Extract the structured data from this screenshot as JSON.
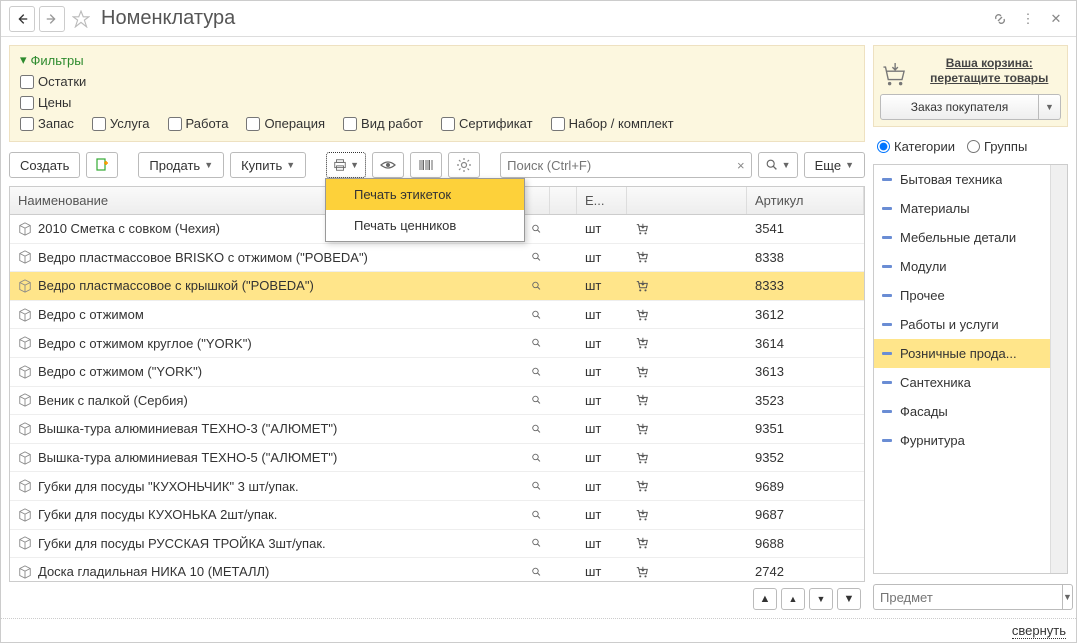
{
  "title": "Номенклатура",
  "filters": {
    "label": "Фильтры",
    "row1": [
      "Остатки"
    ],
    "row2": [
      "Цены"
    ],
    "row3": [
      "Запас",
      "Услуга",
      "Работа",
      "Операция",
      "Вид работ",
      "Сертификат",
      "Набор / комплект"
    ]
  },
  "toolbar": {
    "create": "Создать",
    "sell": "Продать",
    "buy": "Купить",
    "more": "Еще",
    "search_placeholder": "Поиск (Ctrl+F)"
  },
  "dropdown": {
    "opt1": "Печать этикеток",
    "opt2": "Печать ценников"
  },
  "columns": {
    "name": "Наименование",
    "unit": "Е...",
    "art": "Артикул"
  },
  "rows": [
    {
      "name": "2010 Сметка с совком (Чехия)",
      "unit": "шт",
      "art": "3541",
      "sel": false
    },
    {
      "name": "Ведро пластмассовое BRISKO с отжимом (\"POBEDA\")",
      "unit": "шт",
      "art": "8338",
      "sel": false
    },
    {
      "name": "Ведро пластмассовое с крышкой (\"POBEDA\")",
      "unit": "шт",
      "art": "8333",
      "sel": true
    },
    {
      "name": "Ведро с отжимом",
      "unit": "шт",
      "art": "3612",
      "sel": false
    },
    {
      "name": "Ведро с отжимом  круглое (\"YORK\")",
      "unit": "шт",
      "art": "3614",
      "sel": false
    },
    {
      "name": "Ведро с отжимом (\"YORK\")",
      "unit": "шт",
      "art": "3613",
      "sel": false
    },
    {
      "name": "Веник с палкой (Сербия)",
      "unit": "шт",
      "art": "3523",
      "sel": false
    },
    {
      "name": "Вышка-тура алюминиевая ТЕХНО-3 (\"АЛЮМЕТ\")",
      "unit": "шт",
      "art": "9351",
      "sel": false
    },
    {
      "name": "Вышка-тура алюминиевая ТЕХНО-5 (\"АЛЮМЕТ\")",
      "unit": "шт",
      "art": "9352",
      "sel": false
    },
    {
      "name": "Губки для посуды \"КУХОНЬЧИК\" 3 шт/упак.",
      "unit": "шт",
      "art": "9689",
      "sel": false
    },
    {
      "name": "Губки для посуды КУХОНЬКА 2шт/упак.",
      "unit": "шт",
      "art": "9687",
      "sel": false
    },
    {
      "name": "Губки для посуды РУССКАЯ ТРОЙКА 3шт/упак.",
      "unit": "шт",
      "art": "9688",
      "sel": false
    },
    {
      "name": "Доска гладильная  НИКА 10 (МЕТАЛЛ)",
      "unit": "шт",
      "art": "2742",
      "sel": false
    }
  ],
  "cart": {
    "label": "Ваша корзина: перетащите товары",
    "order_btn": "Заказ покупателя"
  },
  "radios": {
    "cat": "Категории",
    "grp": "Группы"
  },
  "categories": [
    {
      "name": "Бытовая техника",
      "sel": false
    },
    {
      "name": "Материалы",
      "sel": false
    },
    {
      "name": "Мебельные детали",
      "sel": false
    },
    {
      "name": "Модули",
      "sel": false
    },
    {
      "name": "Прочее",
      "sel": false
    },
    {
      "name": "Работы и услуги",
      "sel": false
    },
    {
      "name": "Розничные прода...",
      "sel": true
    },
    {
      "name": "Сантехника",
      "sel": false
    },
    {
      "name": "Фасады",
      "sel": false
    },
    {
      "name": "Фурнитура",
      "sel": false
    }
  ],
  "subject_placeholder": "Предмет",
  "collapse": "свернуть"
}
